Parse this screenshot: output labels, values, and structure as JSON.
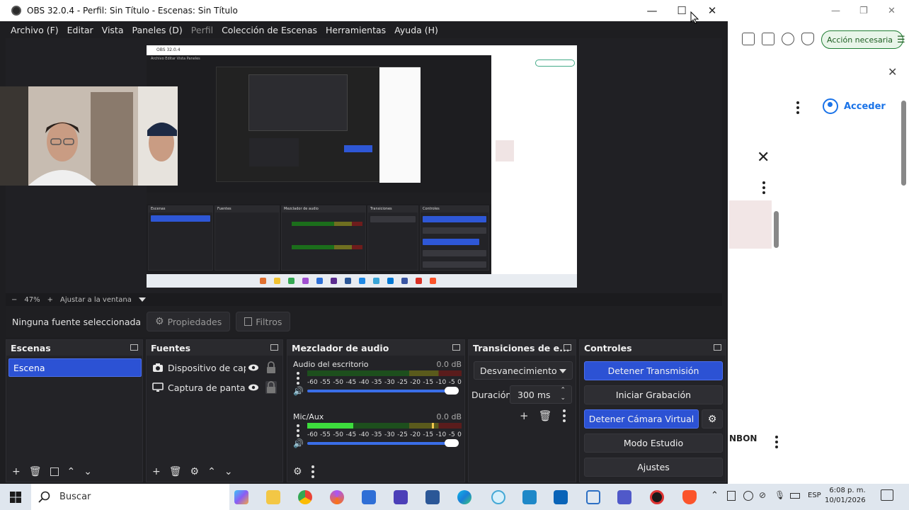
{
  "obs_window": {
    "title": "OBS 32.0.4 - Perfil: Sin Título - Escenas: Sin Título",
    "menu": [
      {
        "label": "Archivo (F)",
        "enabled": true
      },
      {
        "label": "Editar",
        "enabled": true
      },
      {
        "label": "Vista",
        "enabled": true
      },
      {
        "label": "Paneles (D)",
        "enabled": true
      },
      {
        "label": "Perfil",
        "enabled": false
      },
      {
        "label": "Colección de Escenas",
        "enabled": true
      },
      {
        "label": "Herramientas",
        "enabled": true
      },
      {
        "label": "Ayuda (H)",
        "enabled": true
      }
    ]
  },
  "zoom_bar": {
    "minus": "−",
    "zoom_level": "47%",
    "plus": "+",
    "fit_label": "Ajustar a la ventana"
  },
  "source_toolbar": {
    "no_source": "Ninguna fuente seleccionada",
    "properties_label": "Propiedades",
    "filters_label": "Filtros"
  },
  "scenes_dock": {
    "title": "Escenas",
    "items": [
      "Escena"
    ],
    "selected": "Escena"
  },
  "sources_dock": {
    "title": "Fuentes",
    "items": [
      {
        "name": "Dispositivo de captura de video",
        "icon": "camera-icon"
      },
      {
        "name": "Captura de pantalla",
        "icon": "monitor-icon"
      }
    ]
  },
  "mixer_dock": {
    "title": "Mezclador de audio",
    "channels": [
      {
        "name": "Audio del escritorio",
        "db": "0.0 dB",
        "level": 0.0
      },
      {
        "name": "Mic/Aux",
        "db": "0.0 dB",
        "level": 0.3
      }
    ],
    "ticks": [
      "-60",
      "-55",
      "-50",
      "-45",
      "-40",
      "-35",
      "-30",
      "-25",
      "-20",
      "-15",
      "-10",
      "-5",
      "0"
    ]
  },
  "transitions_dock": {
    "title": "Transiciones de escena",
    "title_visible": "Transiciones de e...",
    "transition": "Desvanecimiento",
    "duration_label": "Duración",
    "duration_value": "300 ms"
  },
  "controls_dock": {
    "title": "Controles",
    "buttons": [
      {
        "label": "Detener Transmisión",
        "active": true
      },
      {
        "label": "Iniciar Grabación",
        "active": false
      },
      {
        "label": "Detener Cámara Virtual",
        "active": true
      },
      {
        "label": "Modo Estudio",
        "active": false
      },
      {
        "label": "Ajustes",
        "active": false
      }
    ]
  },
  "browser": {
    "action_button": "Acción necesaria",
    "sign_in": "Acceder",
    "partial_text": "NBON"
  },
  "taskbar": {
    "search_placeholder": "Buscar",
    "language": "ESP",
    "time": "6:08 p. m.",
    "date": "10/01/2026"
  },
  "colors": {
    "accent_blue": "#2c52d4",
    "obs_bg": "#1e1e21",
    "meter_green": "#3ddc3d"
  }
}
